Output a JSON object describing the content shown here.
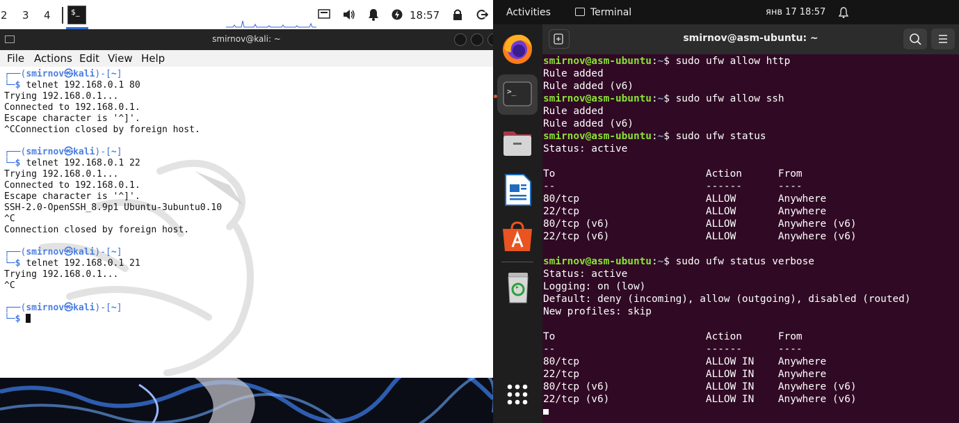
{
  "kali": {
    "panel": {
      "workspaces": [
        "2",
        "3",
        "4"
      ],
      "clock": "18:57"
    },
    "window": {
      "title": "smirnov@kali: ~"
    },
    "menu": [
      "File",
      "Actions",
      "Edit",
      "View",
      "Help"
    ],
    "prompt": {
      "user": "smirnov",
      "host": "kali",
      "dir": "~"
    },
    "blocks": [
      {
        "cmd": "telnet 192.168.0.1 80",
        "out": [
          "Trying 192.168.0.1...",
          "Connected to 192.168.0.1.",
          "Escape character is '^]'.",
          "^CConnection closed by foreign host."
        ]
      },
      {
        "cmd": "telnet 192.168.0.1 22",
        "out": [
          "Trying 192.168.0.1...",
          "Connected to 192.168.0.1.",
          "Escape character is '^]'.",
          "SSH-2.0-OpenSSH_8.9p1 Ubuntu-3ubuntu0.10",
          "^C",
          "Connection closed by foreign host."
        ]
      },
      {
        "cmd": "telnet 192.168.0.1 21",
        "out": [
          "Trying 192.168.0.1...",
          "^C"
        ]
      }
    ]
  },
  "ubuntu": {
    "topbar": {
      "activities": "Activities",
      "app": "Terminal",
      "clock": "янв 17  18:57"
    },
    "headerbar": {
      "title": "smirnov@asm-ubuntu: ~"
    },
    "dock": [
      "firefox-icon",
      "terminal-icon",
      "files-icon",
      "writer-icon",
      "app-center-icon",
      "trash-icon",
      "show-apps-icon"
    ],
    "prompt": {
      "userhost": "smirnov@asm-ubuntu",
      "dir": "~"
    },
    "lines": [
      {
        "type": "cmd",
        "text": "sudo ufw allow http"
      },
      {
        "type": "out",
        "text": "Rule added"
      },
      {
        "type": "out",
        "text": "Rule added (v6)"
      },
      {
        "type": "cmd",
        "text": "sudo ufw allow ssh"
      },
      {
        "type": "out",
        "text": "Rule added"
      },
      {
        "type": "out",
        "text": "Rule added (v6)"
      },
      {
        "type": "cmd",
        "text": "sudo ufw status"
      },
      {
        "type": "out",
        "text": "Status: active"
      },
      {
        "type": "out",
        "text": ""
      },
      {
        "type": "out",
        "text": "To                         Action      From"
      },
      {
        "type": "out",
        "text": "--                         ------      ----"
      },
      {
        "type": "out",
        "text": "80/tcp                     ALLOW       Anywhere"
      },
      {
        "type": "out",
        "text": "22/tcp                     ALLOW       Anywhere"
      },
      {
        "type": "out",
        "text": "80/tcp (v6)                ALLOW       Anywhere (v6)"
      },
      {
        "type": "out",
        "text": "22/tcp (v6)                ALLOW       Anywhere (v6)"
      },
      {
        "type": "out",
        "text": ""
      },
      {
        "type": "cmd",
        "text": "sudo ufw status verbose"
      },
      {
        "type": "out",
        "text": "Status: active"
      },
      {
        "type": "out",
        "text": "Logging: on (low)"
      },
      {
        "type": "out",
        "text": "Default: deny (incoming), allow (outgoing), disabled (routed)"
      },
      {
        "type": "out",
        "text": "New profiles: skip"
      },
      {
        "type": "out",
        "text": ""
      },
      {
        "type": "out",
        "text": "To                         Action      From"
      },
      {
        "type": "out",
        "text": "--                         ------      ----"
      },
      {
        "type": "out",
        "text": "80/tcp                     ALLOW IN    Anywhere"
      },
      {
        "type": "out",
        "text": "22/tcp                     ALLOW IN    Anywhere"
      },
      {
        "type": "out",
        "text": "80/tcp (v6)                ALLOW IN    Anywhere (v6)"
      },
      {
        "type": "out",
        "text": "22/tcp (v6)                ALLOW IN    Anywhere (v6)"
      }
    ]
  },
  "colors": {
    "kali_prompt": "#3a6fd8",
    "ubuntu_bg": "#300a24",
    "ubuntu_green": "#8ae234",
    "ubuntu_blue": "#729fcf",
    "ubuntu_accent": "#e95420"
  }
}
